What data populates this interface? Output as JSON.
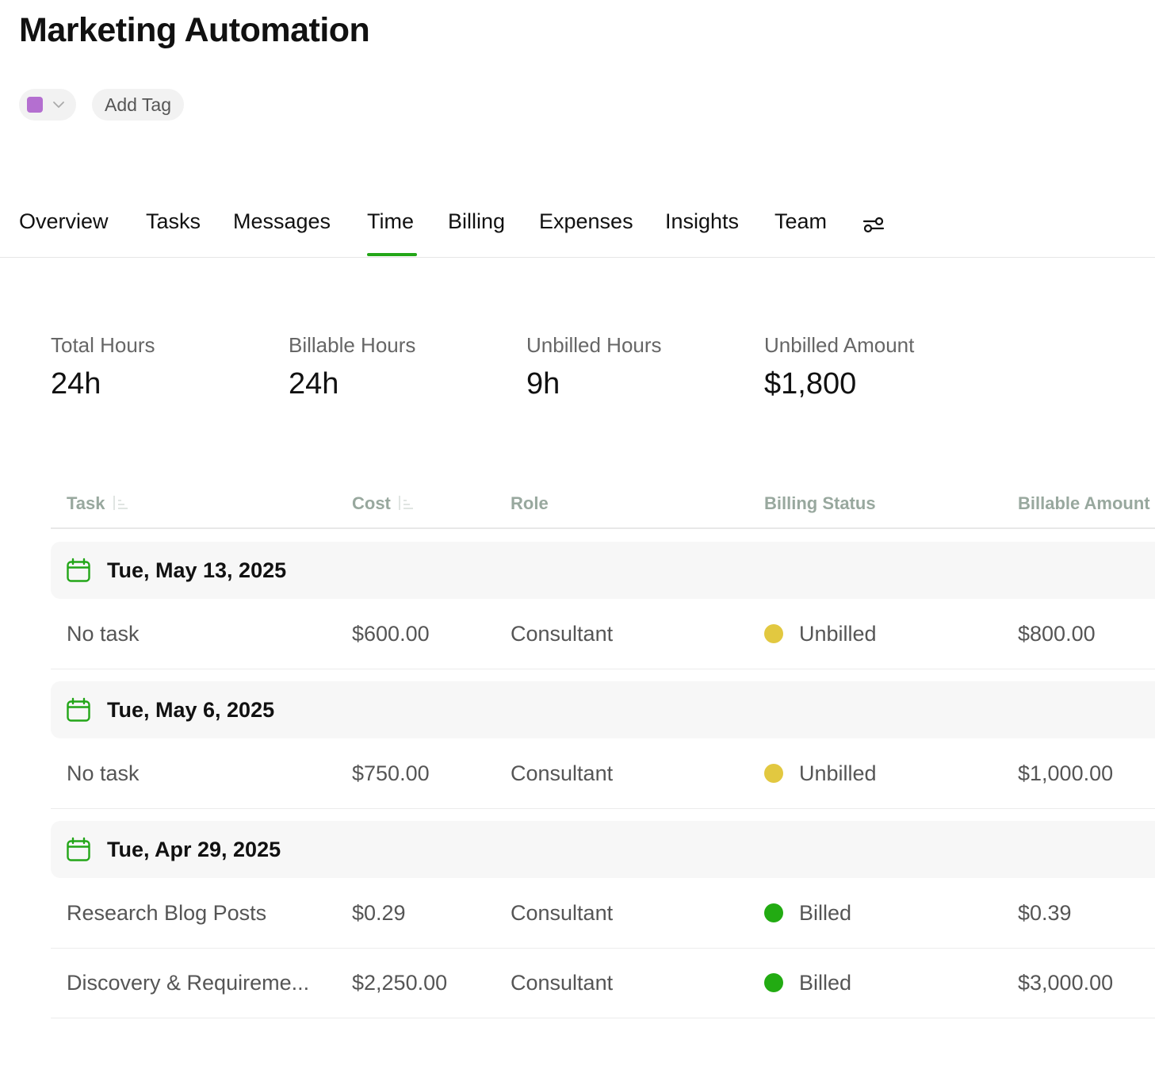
{
  "project": {
    "title": "Marketing Automation",
    "color": "#b46fd0",
    "add_tag_label": "Add Tag"
  },
  "tabs": [
    {
      "label": "Overview"
    },
    {
      "label": "Tasks"
    },
    {
      "label": "Messages"
    },
    {
      "label": "Time",
      "active": true
    },
    {
      "label": "Billing"
    },
    {
      "label": "Expenses"
    },
    {
      "label": "Insights"
    },
    {
      "label": "Team"
    }
  ],
  "tabs_settings_icon": "sliders-icon",
  "accent_color": "#23a618",
  "stats": [
    {
      "label": "Total Hours",
      "value": "24h"
    },
    {
      "label": "Billable Hours",
      "value": "24h"
    },
    {
      "label": "Unbilled Hours",
      "value": "9h"
    },
    {
      "label": "Unbilled Amount",
      "value": "$1,800"
    }
  ],
  "table": {
    "columns": [
      "Task",
      "Cost",
      "Role",
      "Billing Status",
      "Billable Amount"
    ],
    "status_colors": {
      "Unbilled": "#e2c840",
      "Billed": "#22ab12"
    },
    "groups": [
      {
        "date": "Tue, May 13, 2025",
        "rows": [
          {
            "task": "No task",
            "cost": "$600.00",
            "role": "Consultant",
            "status": "Unbilled",
            "amount": "$800.00"
          }
        ]
      },
      {
        "date": "Tue, May 6, 2025",
        "rows": [
          {
            "task": "No task",
            "cost": "$750.00",
            "role": "Consultant",
            "status": "Unbilled",
            "amount": "$1,000.00"
          }
        ]
      },
      {
        "date": "Tue, Apr 29, 2025",
        "rows": [
          {
            "task": "Research Blog Posts",
            "cost": "$0.29",
            "role": "Consultant",
            "status": "Billed",
            "amount": "$0.39"
          },
          {
            "task": "Discovery & Requireme...",
            "cost": "$2,250.00",
            "role": "Consultant",
            "status": "Billed",
            "amount": "$3,000.00"
          }
        ]
      }
    ]
  }
}
